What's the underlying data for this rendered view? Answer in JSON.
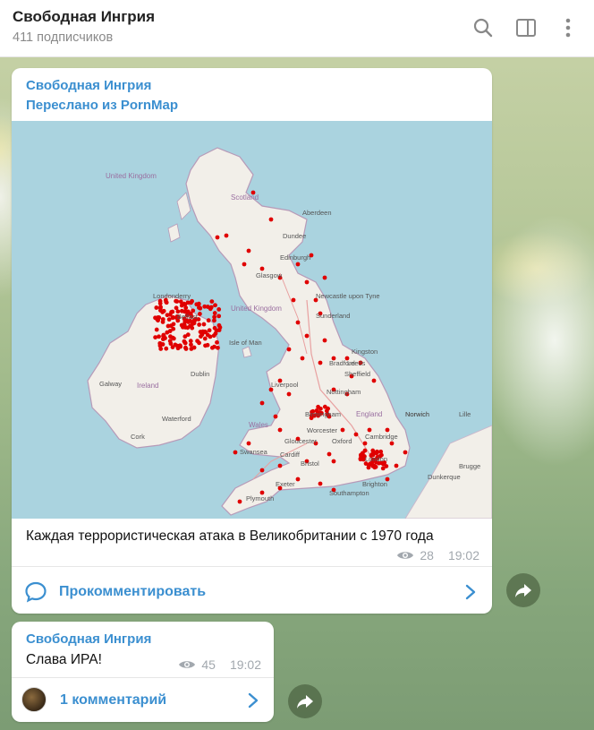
{
  "header": {
    "title": "Свободная Ингрия",
    "subscribers": "411 подписчиков"
  },
  "post1": {
    "author": "Свободная Ингрия",
    "forwarded": "Переслано из PornMap",
    "caption": "Каждая террористическая атака в Великобритании с 1970 года",
    "views": "28",
    "time": "19:02",
    "comment_label": "Прокомментировать",
    "map": {
      "labels": [
        "United Kingdom",
        "Scotland",
        "Aberdeen",
        "Dundee",
        "Edinburgh",
        "Glasgow",
        "Newcastle upon Tyne",
        "Sunderland",
        "United Kingdom",
        "Isle of Man",
        "Londonderry",
        "Belfast",
        "Dublin",
        "Ireland",
        "Galway",
        "Waterford",
        "Cork",
        "Kingston",
        "Bradford",
        "Leeds",
        "Sheffield",
        "Nottingham",
        "England",
        "Birmingham",
        "Cambridge",
        "Norwich",
        "Liverpool",
        "Oxford",
        "Gloucester",
        "Cardiff",
        "Swansea",
        "Bristol",
        "Exeter",
        "Plymouth",
        "Southampton",
        "Brighton",
        "London",
        "Lille",
        "Brugge",
        "Dunkerque",
        "Worcester",
        "Norwich",
        "Wales"
      ]
    }
  },
  "post2": {
    "author": "Свободная Ингрия",
    "text": "Слава ИРА!",
    "views": "45",
    "time": "19:02",
    "comment_label": "1 комментарий"
  },
  "colors": {
    "accent": "#3b8fd0",
    "dot": "#e00000"
  },
  "icons": [
    "search-icon",
    "sidebar-toggle-icon",
    "more-vert-icon",
    "eye-icon",
    "comment-icon",
    "chevron-right-icon",
    "share-icon"
  ]
}
